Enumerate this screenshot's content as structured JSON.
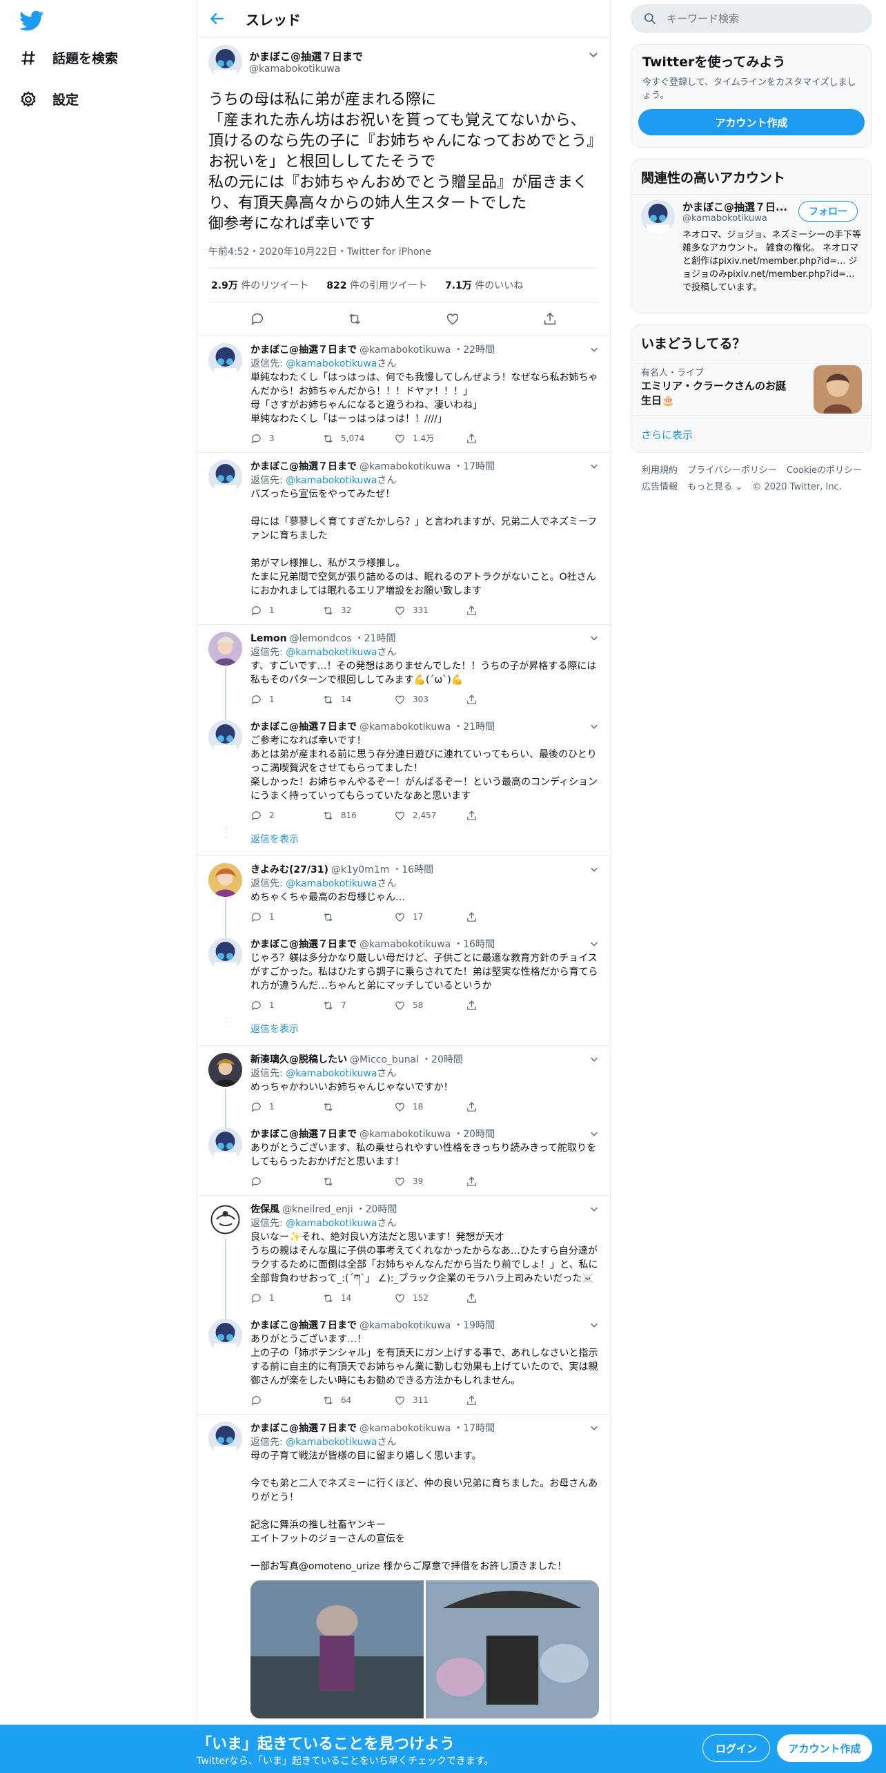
{
  "nav": {
    "explore": "話題を検索",
    "settings": "設定"
  },
  "header": {
    "title": "スレッド"
  },
  "focal": {
    "name": "かまぼこ@抽選７日まで",
    "handle": "@kamabokotikuwa",
    "text": "うちの母は私に弟が産まれる際に\n「産まれた赤ん坊はお祝いを貰っても覚えてないから、頂けるのなら先の子に『お姉ちゃんになっておめでとう』お祝いを」と根回ししてたそうで\n私の元には『お姉ちゃんおめでとう贈呈品』が届きまくり、有頂天鼻高々からの姉人生スタートでした\n御参考になれば幸いです",
    "meta": "午前4:52・2020年10月22日・Twitter for iPhone",
    "retweets_num": "2.9万",
    "retweets_label": "件のリツイート",
    "quotes_num": "822",
    "quotes_label": "件の引用ツイート",
    "likes_num": "7.1万",
    "likes_label": "件のいいね"
  },
  "reply_prefix": "返信先: ",
  "reply_suffix": "さん",
  "show_replies": "返信を表示",
  "replies": [
    {
      "name": "かまぼこ@抽選７日まで",
      "handle": "@kamabokotikuwa",
      "time": "・22時間",
      "reply_to": "@kamabokotikuwa",
      "text": "単純なわたくし「はっはっは、何でも我慢してしんぜよう！なぜなら私お姉ちゃんだから！お姉ちゃんだから！！！ドヤァ！！！」\n母「さすがお姉ちゃんになると違うわね、凄いわね」\n単純なわたくし「はーっはっはっは！！////」",
      "reply": "3",
      "retweet": "5,074",
      "like": "1.4万"
    },
    {
      "name": "かまぼこ@抽選７日まで",
      "handle": "@kamabokotikuwa",
      "time": "・17時間",
      "reply_to": "@kamabokotikuwa",
      "text": "バズったら宣伝をやってみたぜ！\n\n母には「蓼蓼しく育てすぎたかしら？」と言われますが、兄弟二人でネズミーファンに育ちました\n\n弟がマレ様推し、私がスラ様推し。\nたまに兄弟間で空気が張り詰めるのは、眠れるのアトラクがないこと。O社さんにおかれましては眠れるエリア増設をお願い致します",
      "reply": "1",
      "retweet": "32",
      "like": "331"
    },
    {
      "name": "Lemon",
      "handle": "@lemondcos",
      "time": "・21時間",
      "reply_to": "@kamabokotikuwa",
      "text": "す、すごいです…！その発想はありませんでした！！うちの子が昇格する際には私もそのパターンで根回ししてみます💪(ˊωˋ)💪",
      "reply": "1",
      "retweet": "14",
      "like": "303"
    },
    {
      "name": "かまぼこ@抽選７日まで",
      "handle": "@kamabokotikuwa",
      "time": "・21時間",
      "reply_to": "",
      "text": "ご参考になれば幸いです！\nあとは弟が産まれる前に思う存分連日遊びに連れていってもらい、最後のひとりっこ満喫贅沢をさせてもらってました！\n楽しかった！お姉ちゃんやるぞー！がんばるぞー！という最高のコンディションにうまく持っていってもらっていたなあと思います",
      "reply": "2",
      "retweet": "816",
      "like": "2,457"
    },
    {
      "name": "きよみむ(27/31)",
      "handle": "@k1y0m1m",
      "time": "・16時間",
      "reply_to": "@kamabokotikuwa",
      "text": "めちゃくちゃ最高のお母様じゃん…",
      "reply": "1",
      "retweet": "",
      "like": "17"
    },
    {
      "name": "かまぼこ@抽選７日まで",
      "handle": "@kamabokotikuwa",
      "time": "・16時間",
      "reply_to": "",
      "text": "じゃろ？躾は多分かなり厳しい母だけど、子供ごとに最適な教育方針のチョイスがすごかった。私はひたすら調子に乗らされてた！弟は堅実な性格だから育てられ方が違うんだ…ちゃんと弟にマッチしているというか",
      "reply": "1",
      "retweet": "7",
      "like": "58"
    },
    {
      "name": "新湊璃久@脱稿したい",
      "handle": "@Micco_bunal",
      "time": "・20時間",
      "reply_to": "@kamabokotikuwa",
      "text": "めっちゃかわいいお姉ちゃんじゃないですか！",
      "reply": "1",
      "retweet": "",
      "like": "18"
    },
    {
      "name": "かまぼこ@抽選７日まで",
      "handle": "@kamabokotikuwa",
      "time": "・20時間",
      "reply_to": "",
      "text": "ありがとうございます、私の乗せられやすい性格をきっちり読みきって舵取りをしてもらったおかげだと思います！",
      "reply": "",
      "retweet": "",
      "like": "39"
    },
    {
      "name": "佐保風",
      "handle": "@kneilred_enji",
      "time": "・20時間",
      "reply_to": "@kamabokotikuwa",
      "text": "良いなー✨それ、絶対良い方法だと思います！発想が天才\nうちの親はそんな風に子供の事考えてくれなかったからなあ…ひたすら自分達がラクするために面倒は全部「お姉ちゃんなんだから当たり前でしょ！」と、私に全部背負わせおって_:(´ཀ`」 ∠):_ブラック企業のモラハラ上司みたいだった☠️",
      "reply": "1",
      "retweet": "14",
      "like": "152"
    },
    {
      "name": "かまぼこ@抽選７日まで",
      "handle": "@kamabokotikuwa",
      "time": "・19時間",
      "reply_to": "",
      "text": "ありがとうございます…！\n上の子の「姉ポテンシャル」を有頂天にガン上げする事で、あれしなさいと指示する前に自主的に有頂天でお姉ちゃん業に勤しむ効果も上げていたので、実は親御さんが楽をしたい時にもお勧めできる方法かもしれません。",
      "reply": "",
      "retweet": "64",
      "like": "311"
    },
    {
      "name": "かまぼこ@抽選７日まで",
      "handle": "@kamabokotikuwa",
      "time": "・17時間",
      "reply_to": "@kamabokotikuwa",
      "text": "母の子育て戦法が皆様の目に留まり嬉しく思います。\n\n今でも弟と二人でネズミーに行くほど、仲の良い兄弟に育ちました。お母さんありがとう！\n\n記念に舞浜の推し社畜ヤンキー\nエイトフットのジョーさんの宣伝を\n\n一部お写真@omoteno_urize 様からご厚意で拝借をお許し頂きました！",
      "reply": "",
      "retweet": "",
      "like": ""
    }
  ],
  "search": {
    "placeholder": "キーワード検索"
  },
  "signup_card": {
    "title": "Twitterを使ってみよう",
    "desc": "今すぐ登録して、タイムラインをカスタマイズしましょう。",
    "button": "アカウント作成"
  },
  "related": {
    "title": "関連性の高いアカウント",
    "name": "かまぼこ@抽選７日...",
    "handle": "@kamabokotikuwa",
    "follow": "フォロー",
    "bio": "ネオロマ、ジョジョ、ネズミーシーの手下等雑多なアカウント。 雑食の権化。 ネオロマと創作はpixiv.net/member.php?id=... ジョジョのみpixiv.net/member.php?id=... で投稿しています。"
  },
  "trends": {
    "title": "いまどうしてる？",
    "category": "有名人・ライブ",
    "topic": "エミリア・クラークさんのお誕生日🎂",
    "more": "さらに表示"
  },
  "footer": [
    "利用規約",
    "プライバシーポリシー",
    "Cookieのポリシー",
    "広告情報",
    "もっと見る ⌄",
    "© 2020 Twitter, Inc."
  ],
  "bottom_bar": {
    "title": "「いま」起きていることを見つけよう",
    "subtitle": "Twitterなら、「いま」起きていることをいち早くチェックできます。",
    "login": "ログイン",
    "signup": "アカウント作成"
  },
  "colors": {
    "accent": "#1d9bf0",
    "bottom_bar": "#1da1f2"
  }
}
